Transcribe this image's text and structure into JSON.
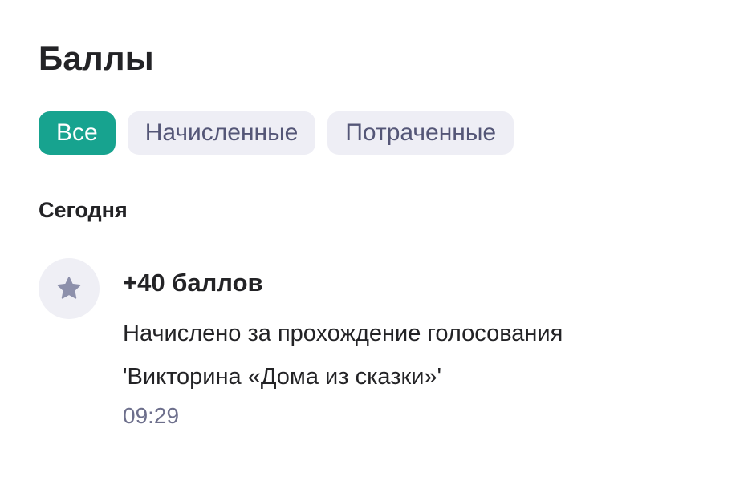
{
  "header": {
    "title": "Баллы"
  },
  "filters": {
    "all": "Все",
    "earned": "Начисленные",
    "spent": "Потраченные",
    "active": "all"
  },
  "colors": {
    "accent": "#17a38f",
    "chip_bg": "#eeeef5",
    "chip_text": "#545677",
    "muted_text": "#6d6f8c",
    "icon_bg": "#efeff5",
    "icon_fill": "#8d90ab"
  },
  "sections": [
    {
      "title": "Сегодня",
      "transactions": [
        {
          "icon": "star-icon",
          "points": "+40 баллов",
          "description_line1": "Начислено за прохождение голосования",
          "description_line2": "'Викторина «Дома из сказки»'",
          "time": "09:29"
        }
      ]
    }
  ]
}
